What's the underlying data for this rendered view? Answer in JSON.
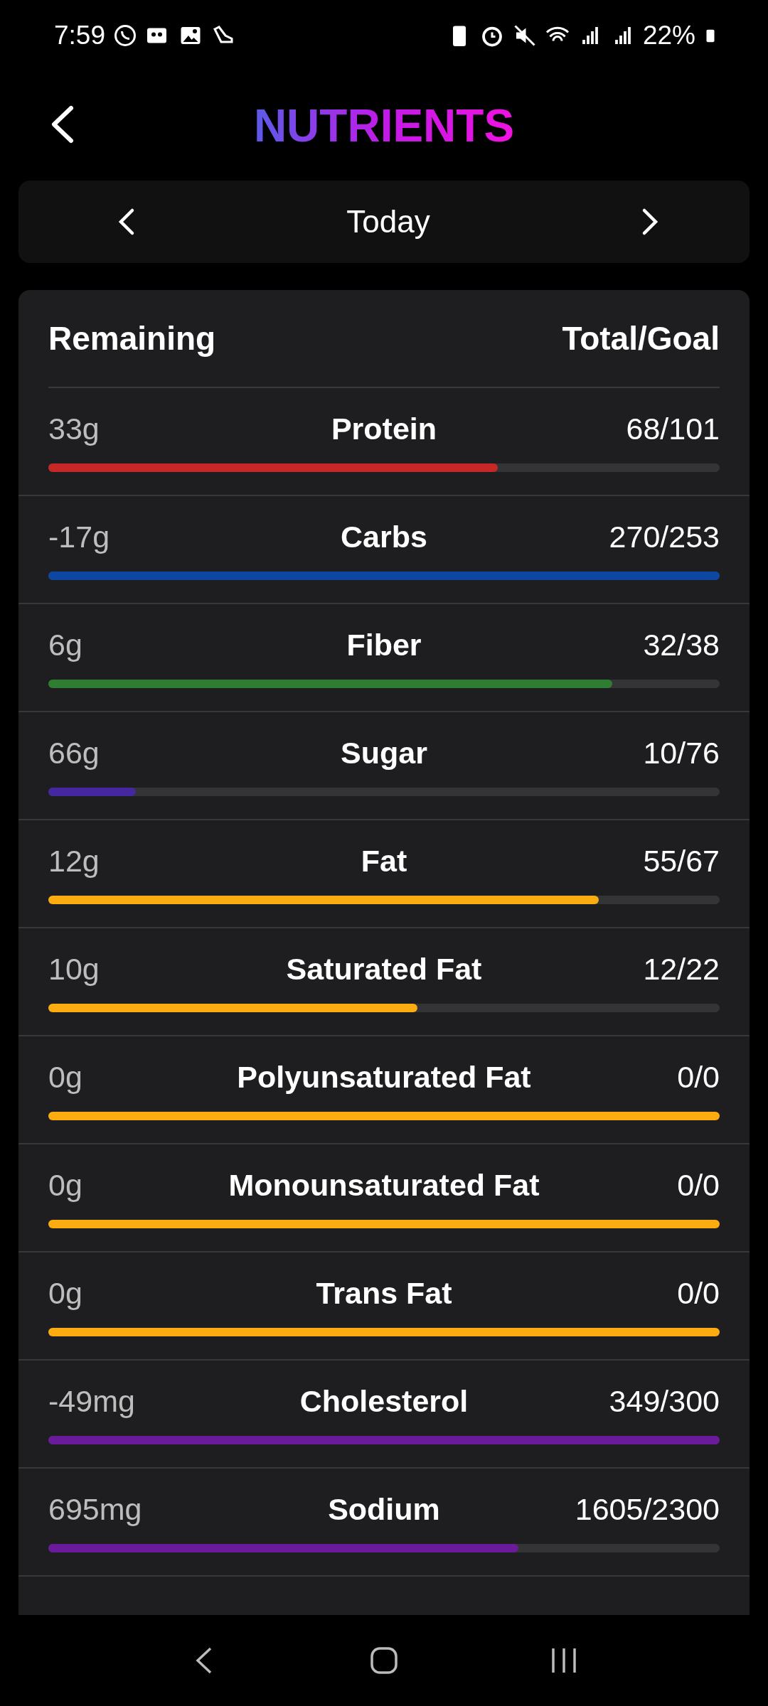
{
  "status_bar": {
    "time": "7:59",
    "battery": "22%"
  },
  "header": {
    "title": "NUTRIENTS"
  },
  "date_nav": {
    "label": "Today"
  },
  "table": {
    "columns": [
      "Remaining",
      "Total/Goal"
    ],
    "rows": [
      {
        "remaining": "33g",
        "name": "Protein",
        "total": "68/101",
        "level": 0.67,
        "color": "#c62828"
      },
      {
        "remaining": "-17g",
        "name": "Carbs",
        "total": "270/253",
        "level": 1,
        "color": "#0d47a1"
      },
      {
        "remaining": "6g",
        "name": "Fiber",
        "total": "32/38",
        "level": 0.84,
        "color": "#2e7d32"
      },
      {
        "remaining": "66g",
        "name": "Sugar",
        "total": "10/76",
        "level": 0.13,
        "color": "#4527a0"
      },
      {
        "remaining": "12g",
        "name": "Fat",
        "total": "55/67",
        "level": 0.82,
        "color": "#fbac10"
      },
      {
        "remaining": "10g",
        "name": "Saturated Fat",
        "total": "12/22",
        "level": 0.55,
        "color": "#fbac10"
      },
      {
        "remaining": "0g",
        "name": "Polyunsaturated Fat",
        "total": "0/0",
        "level": 1,
        "color": "#fbac10"
      },
      {
        "remaining": "0g",
        "name": "Monounsaturated Fat",
        "total": "0/0",
        "level": 1,
        "color": "#fbac10"
      },
      {
        "remaining": "0g",
        "name": "Trans Fat",
        "total": "0/0",
        "level": 1,
        "color": "#fbac10"
      },
      {
        "remaining": "-49mg",
        "name": "Cholesterol",
        "total": "349/300",
        "level": 1,
        "color": "#6a1b9a"
      },
      {
        "remaining": "695mg",
        "name": "Sodium",
        "total": "1605/2300",
        "level": 0.7,
        "color": "#6a1b9a"
      }
    ]
  }
}
